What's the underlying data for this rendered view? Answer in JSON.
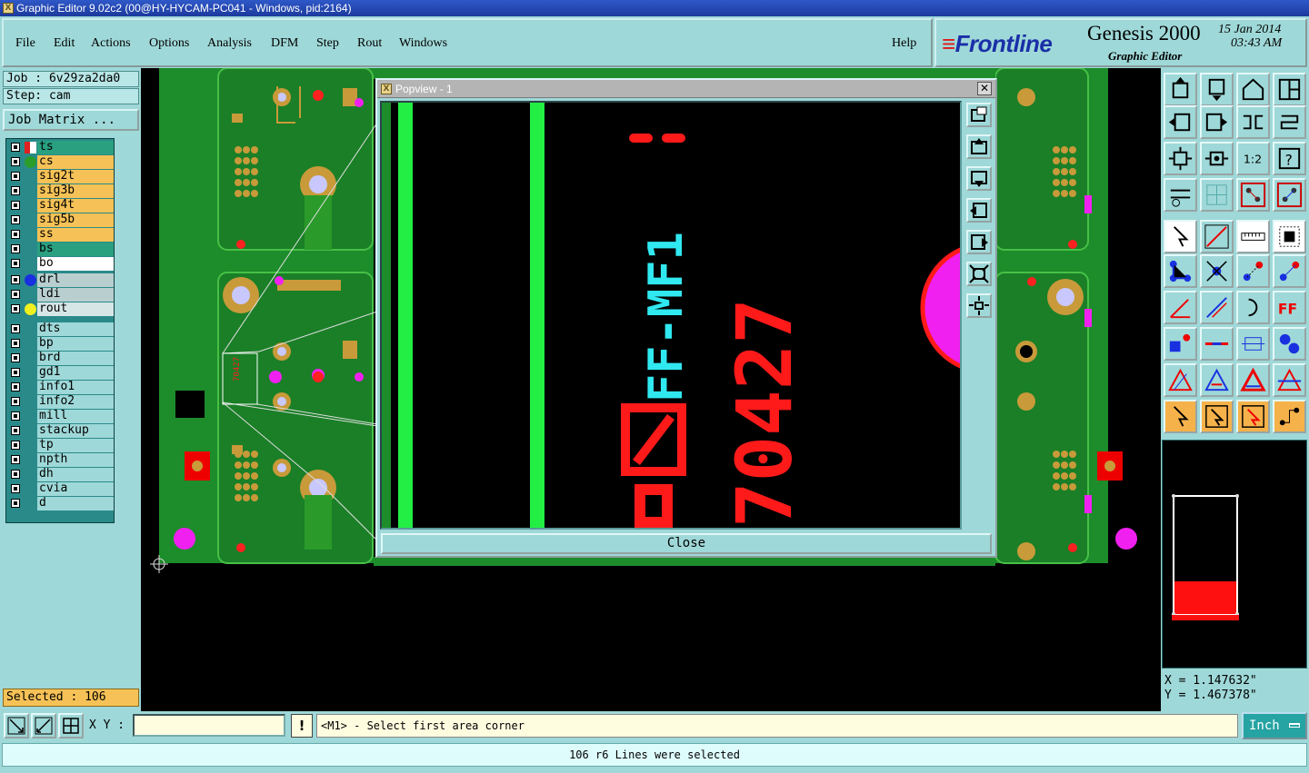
{
  "window": {
    "title": "Graphic Editor 9.02c2 (00@HY-HYCAM-PC041 - Windows, pid:2164)"
  },
  "menu": {
    "file": "File",
    "edit": "Edit",
    "actions": "Actions",
    "options": "Options",
    "analysis": "Analysis",
    "dfm": "DFM",
    "step": "Step",
    "rout": "Rout",
    "windows": "Windows",
    "help": "Help"
  },
  "brand": {
    "logo": "Frontline",
    "product": "Genesis 2000",
    "subtitle": "Graphic Editor",
    "date": "15 Jan 2014",
    "time": "03:43 AM"
  },
  "job": {
    "job_label": "Job : 6v29za2da0",
    "step_label": "Step: cam",
    "matrix_button": "Job Matrix ..."
  },
  "layers": [
    {
      "name": "ts",
      "bg": "#2aa080",
      "dot": "#ffffff",
      "mark": "pencil-icon"
    },
    {
      "name": "cs",
      "bg": "#f6c257",
      "dot": "#2a9d2a"
    },
    {
      "name": "sig2t",
      "bg": "#f6c257"
    },
    {
      "name": "sig3b",
      "bg": "#f6c257"
    },
    {
      "name": "sig4t",
      "bg": "#f6c257"
    },
    {
      "name": "sig5b",
      "bg": "#f6c257"
    },
    {
      "name": "ss",
      "bg": "#f6c257"
    },
    {
      "name": "bs",
      "bg": "#2aa080"
    },
    {
      "name": "bo",
      "bg": "#ffffff"
    },
    {
      "name": "drl",
      "bg": "#b9cfcf",
      "dot": "#1830e0"
    },
    {
      "name": "ldi",
      "bg": "#b9cfcf"
    },
    {
      "name": "rout",
      "bg": "#d6e6e6",
      "dot": "#f0f020"
    },
    {
      "name": "dts",
      "bg": "#9fd8d8"
    },
    {
      "name": "bp",
      "bg": "#9fd8d8"
    },
    {
      "name": "brd",
      "bg": "#9fd8d8"
    },
    {
      "name": "gd1",
      "bg": "#9fd8d8"
    },
    {
      "name": "info1",
      "bg": "#9fd8d8"
    },
    {
      "name": "info2",
      "bg": "#9fd8d8"
    },
    {
      "name": "mill",
      "bg": "#9fd8d8"
    },
    {
      "name": "stackup",
      "bg": "#9fd8d8"
    },
    {
      "name": "tp",
      "bg": "#9fd8d8"
    },
    {
      "name": "npth",
      "bg": "#9fd8d8"
    },
    {
      "name": "dh",
      "bg": "#9fd8d8"
    },
    {
      "name": "cvia",
      "bg": "#9fd8d8"
    },
    {
      "name": "d",
      "bg": "#9fd8d8"
    }
  ],
  "selected": "Selected : 106",
  "popup": {
    "title": "Popview - 1",
    "close_button": "Close",
    "close_x": "✕",
    "texts": {
      "part_id": "FF-MF1",
      "number": "70427"
    }
  },
  "coords": {
    "x": "X = 1.147632\"",
    "y": "Y = 1.467378\""
  },
  "bottom": {
    "xy_label": "X Y :",
    "xy_value": "",
    "excl": "!",
    "prompt": "<M1> - Select first area corner",
    "units": "Inch",
    "status": "106 r6 Lines were selected"
  },
  "colors": {
    "bg": "#9fd8d8",
    "pcb_green": "#1d8c2b",
    "pad_gold": "#c89a3a",
    "red": "#f01010",
    "magenta": "#f020f0",
    "cyan": "#30e8f0"
  }
}
